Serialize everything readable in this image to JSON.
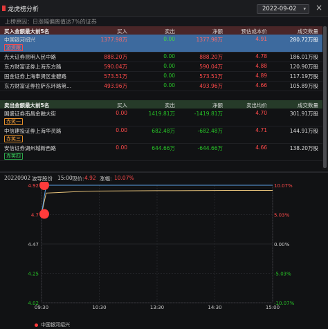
{
  "window": {
    "title": "龙虎榜分析",
    "date": "2022-09-02",
    "close_glyph": "×",
    "chevron_glyph": "▾"
  },
  "reason": "上榜原因：日涨幅偏离值达7%的证券",
  "buy_table": {
    "headers": [
      "买入金额最大前5名",
      "买入",
      "卖出",
      "净额",
      "预估成本价",
      "成交数量"
    ],
    "rows": [
      {
        "name": "中国银河绍兴",
        "buy": "1377.98万",
        "sell": "0.00",
        "net": "1377.98万",
        "price": "4.91",
        "vol": "280.72万股",
        "badge": "游资跟",
        "selected": true
      },
      {
        "name": "光大证券昆明人民中路",
        "buy": "888.20万",
        "sell": "0.00",
        "net": "888.20万",
        "price": "4.78",
        "vol": "186.01万股"
      },
      {
        "name": "东方财富证券上海东方路",
        "buy": "590.04万",
        "sell": "0.00",
        "net": "590.04万",
        "price": "4.88",
        "vol": "120.90万股"
      },
      {
        "name": "国金证券上海奉贤区金碧路",
        "buy": "573.51万",
        "sell": "0.00",
        "net": "573.51万",
        "price": "4.89",
        "vol": "117.19万股"
      },
      {
        "name": "东方财富证券拉萨东环路第...",
        "buy": "493.96万",
        "sell": "0.00",
        "net": "493.96万",
        "price": "4.66",
        "vol": "105.89万股"
      }
    ]
  },
  "sell_table": {
    "headers": [
      "卖出金额最大前5名",
      "买入",
      "卖出",
      "净额",
      "卖出均价",
      "成交数量"
    ],
    "rows": [
      {
        "name": "国盛证券南昌金融大街",
        "buy": "0.00",
        "sell": "1419.81万",
        "net": "-1419.81万",
        "price": "4.70",
        "vol": "301.91万股",
        "badge": "赤笑一",
        "badge_color": "orange"
      },
      {
        "name": "中信建投证券上海华灵路",
        "buy": "0.00",
        "sell": "682.48万",
        "net": "-682.48万",
        "price": "4.71",
        "vol": "144.91万股",
        "badge": "赤笑三",
        "badge_color": "orange"
      },
      {
        "name": "安信证券湖州城新西路",
        "buy": "0.00",
        "sell": "644.66万",
        "net": "-644.66万",
        "price": "4.66",
        "vol": "138.20万股",
        "badge": "赤笑四",
        "badge_color": "green"
      }
    ]
  },
  "chart_header": {
    "date": "20220902",
    "stock": "波导股份",
    "time": "15:00",
    "price_label": "现价:",
    "price": "4.92",
    "change_label": "涨幅:",
    "change": "10.07%"
  },
  "chart_data": {
    "type": "line",
    "x_ticks": [
      "09:30",
      "10:30",
      "13:30",
      "14:30",
      "15:00"
    ],
    "y_left_ticks": [
      "4.92",
      "4.7",
      "4.47",
      "4.25",
      "4.02"
    ],
    "y_right_ticks": [
      "10.07%",
      "5.03%",
      "0.00%",
      "-5.03%",
      "-10.07%"
    ],
    "ylim": [
      4.02,
      4.92
    ],
    "price_series": [
      4.7,
      4.92,
      4.92,
      4.92,
      4.92,
      4.92
    ],
    "avg_series": [
      4.7,
      4.86,
      4.875,
      4.878,
      4.88,
      4.88
    ],
    "x_positions": [
      0,
      0.02,
      0.2,
      0.5,
      0.8,
      1.0
    ],
    "markers": [
      {
        "x": 0,
        "y": 4.92
      },
      {
        "x": 0,
        "y": 4.7
      }
    ],
    "legend": "中国银河绍兴",
    "colors": {
      "price": "#5aa0e6",
      "avg": "#e6c27a",
      "marker": "#ff3b3b",
      "up": "#ff4a4a",
      "down": "#27c227",
      "flat": "#d0d0d0"
    }
  }
}
